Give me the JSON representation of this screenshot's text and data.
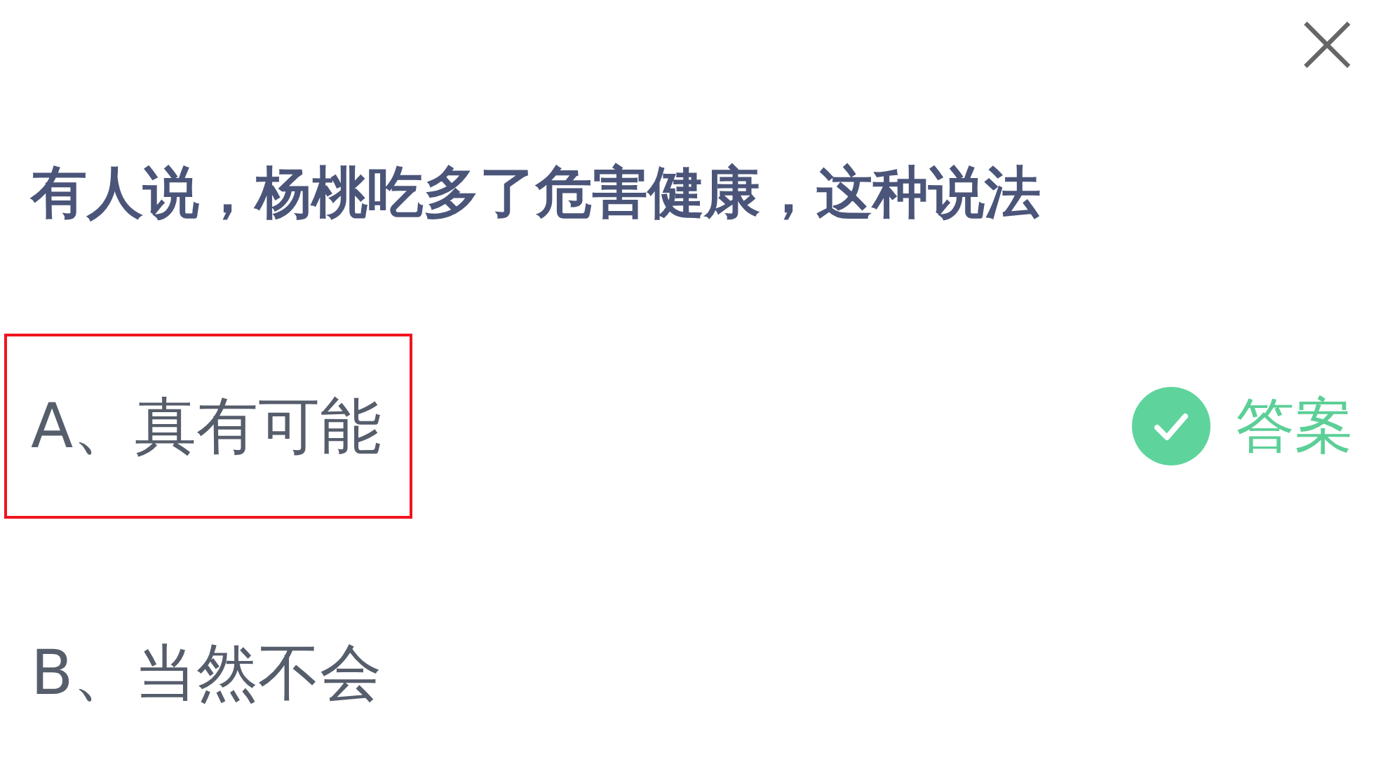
{
  "close": {
    "symbol": "×"
  },
  "question": "有人说，杨桃吃多了危害健康，这种说法",
  "options": [
    {
      "label": "A、真有可能",
      "highlighted": true,
      "correct": true,
      "badge": "答案"
    },
    {
      "label": "B、当然不会",
      "highlighted": false,
      "correct": false
    }
  ]
}
